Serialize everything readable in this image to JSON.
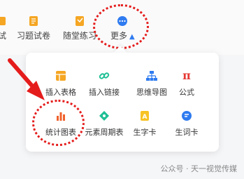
{
  "toolbar": {
    "items": [
      {
        "label": "试"
      },
      {
        "label": "习题试卷"
      },
      {
        "label": "随堂练习"
      },
      {
        "label": "更多"
      }
    ]
  },
  "more_menu": {
    "items": [
      {
        "label": "插入表格",
        "icon": "table-icon"
      },
      {
        "label": "插入链接",
        "icon": "link-icon"
      },
      {
        "label": "思维导图",
        "icon": "mindmap-icon"
      },
      {
        "label": "公式",
        "icon": "pi-icon"
      },
      {
        "label": "统计图表",
        "icon": "bar-chart-icon"
      },
      {
        "label": "元素周期表",
        "icon": "periodic-table-icon"
      },
      {
        "label": "生字卡",
        "icon": "character-card-icon"
      },
      {
        "label": "生词卡",
        "icon": "word-card-icon"
      }
    ]
  },
  "watermark": "公众号 · 天一视觉传媒",
  "colors": {
    "accent": "#2f7bf0",
    "highlight": "#e51c1c",
    "orange": "#f5a623",
    "teal": "#1fbf95"
  }
}
